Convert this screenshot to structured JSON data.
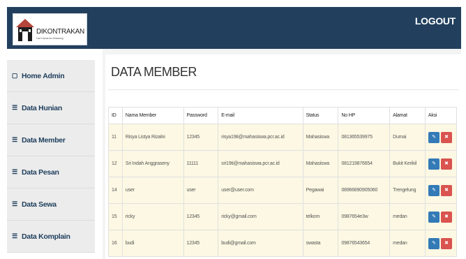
{
  "header": {
    "brand_name": "DIKONTRAKAN",
    "brand_tagline": "Cari Kamarmu Sekarang",
    "logout_label": "LOGOUT"
  },
  "sidebar": {
    "items": [
      {
        "label": "Home Admin",
        "icon": "monitor-icon"
      },
      {
        "label": "Data Hunian",
        "icon": "list-icon"
      },
      {
        "label": "Data Member",
        "icon": "list-icon"
      },
      {
        "label": "Data Pesan",
        "icon": "list-icon"
      },
      {
        "label": "Data Sewa",
        "icon": "list-icon"
      },
      {
        "label": "Data Komplain",
        "icon": "list-icon"
      }
    ]
  },
  "main": {
    "title": "DATA MEMBER",
    "table": {
      "columns": [
        "ID",
        "Nama Member",
        "Password",
        "E-mail",
        "Status",
        "No HP",
        "Alamat",
        "Aksi"
      ],
      "rows": [
        {
          "id": "11",
          "name": "Risya Listya Rizalni",
          "password": "12345",
          "email": "risya19ti@mahasiswa.pcr.ac.id",
          "status": "Mahasiswa",
          "phone": "081365539975",
          "address": "Dumai"
        },
        {
          "id": "12",
          "name": "Sri Indah Anggraseny",
          "password": "11111",
          "email": "sri19ti@mahasiswa.pcr.ac.id",
          "status": "Mahasiswa",
          "phone": "081219876654",
          "address": "Bukit Kerikil"
        },
        {
          "id": "14",
          "name": "user",
          "password": "user",
          "email": "user@user.com",
          "status": "Pegawai",
          "phone": "08966890905060",
          "address": "Trengelung"
        },
        {
          "id": "15",
          "name": "ricky",
          "password": "12345",
          "email": "ricky@gmail.com",
          "status": "telkom",
          "phone": "0987654e3w",
          "address": "medan"
        },
        {
          "id": "16",
          "name": "budi",
          "password": "12345",
          "email": "budi@gmail.com",
          "status": "swasta",
          "phone": "09876543654",
          "address": "medan"
        }
      ]
    }
  },
  "colors": {
    "topbar": "#22405e",
    "row_highlight": "#fcf8e3",
    "edit_button": "#337ab7",
    "delete_button": "#d9534f"
  }
}
